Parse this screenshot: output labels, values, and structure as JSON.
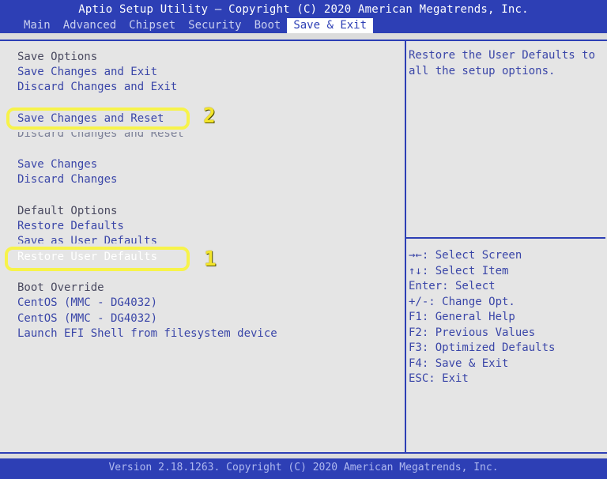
{
  "header": {
    "title": "Aptio Setup Utility – Copyright (C) 2020 American Megatrends, Inc.",
    "tabs": [
      "Main",
      "Advanced",
      "Chipset",
      "Security",
      "Boot",
      "Save & Exit"
    ],
    "active_tab": "Save & Exit"
  },
  "left": {
    "save_options_header": "Save Options",
    "save_changes_and_exit": "Save Changes and Exit",
    "discard_changes_and_exit": "Discard Changes and Exit",
    "save_changes_and_reset": "Save Changes and Reset",
    "discard_changes_and_reset": "Discard Changes and Reset",
    "save_changes": "Save Changes",
    "discard_changes": "Discard Changes",
    "default_options_header": "Default Options",
    "restore_defaults": "Restore Defaults",
    "save_as_user_defaults": "Save as User Defaults",
    "restore_user_defaults": "Restore User Defaults",
    "boot_override_header": "Boot Override",
    "boot_option_1": "CentOS (MMC - DG4032)",
    "boot_option_2": "CentOS (MMC - DG4032)",
    "launch_efi_shell": "Launch EFI Shell from filesystem device"
  },
  "annotations": {
    "badge_1": "1",
    "badge_2": "2",
    "highlight_color": "#f7f34a"
  },
  "right": {
    "help_text": "Restore the User Defaults to all the setup options.",
    "keys": [
      "→←: Select Screen",
      "↑↓: Select Item",
      "Enter: Select",
      "+/-: Change Opt.",
      "F1: General Help",
      "F2: Previous Values",
      "F3: Optimized Defaults",
      "F4: Save & Exit",
      "ESC: Exit"
    ]
  },
  "footer": {
    "text": "Version 2.18.1263. Copyright (C) 2020 American Megatrends, Inc."
  },
  "colors": {
    "bar_blue": "#2d3fb5",
    "item_blue": "#3a46a8",
    "background": "#e5e5e5"
  }
}
